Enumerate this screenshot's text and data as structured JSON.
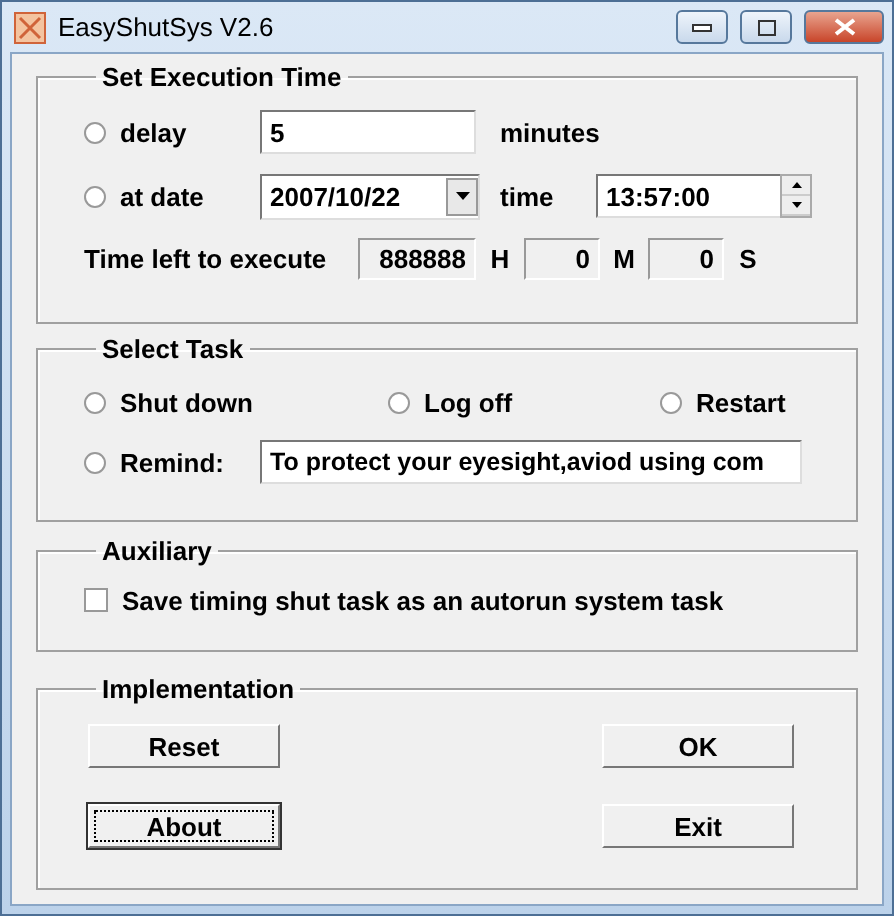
{
  "window": {
    "title": "EasyShutSys V2.6"
  },
  "execution_time": {
    "title": "Set Execution Time",
    "modes": [
      {
        "label": "delay",
        "selected": false
      },
      {
        "label": "at date",
        "selected": false
      }
    ],
    "delay_value": "5",
    "delay_unit": "minutes",
    "date_value": "2007/10/22",
    "time_label": "time",
    "time_value": "13:57:00",
    "time_left_label": "Time left to execute",
    "time_left": [
      {
        "value": "888888",
        "unit": "H"
      },
      {
        "value": "0",
        "unit": "M"
      },
      {
        "value": "0",
        "unit": "S"
      }
    ]
  },
  "task": {
    "title": "Select Task",
    "options": [
      {
        "label": "Shut down",
        "selected": false
      },
      {
        "label": "Log off",
        "selected": false
      },
      {
        "label": "Restart",
        "selected": false
      },
      {
        "label": "Remind:",
        "selected": false
      }
    ],
    "remind_value": "To protect your eyesight,aviod using com"
  },
  "auxiliary": {
    "title": "Auxiliary",
    "autorun": {
      "label": "Save timing shut task as an autorun system task",
      "checked": false
    }
  },
  "implementation": {
    "title": "Implementation",
    "buttons": [
      {
        "label": "Reset",
        "focused": false
      },
      {
        "label": "OK",
        "focused": false
      },
      {
        "label": "About",
        "focused": true
      },
      {
        "label": "Exit",
        "focused": false
      }
    ]
  }
}
